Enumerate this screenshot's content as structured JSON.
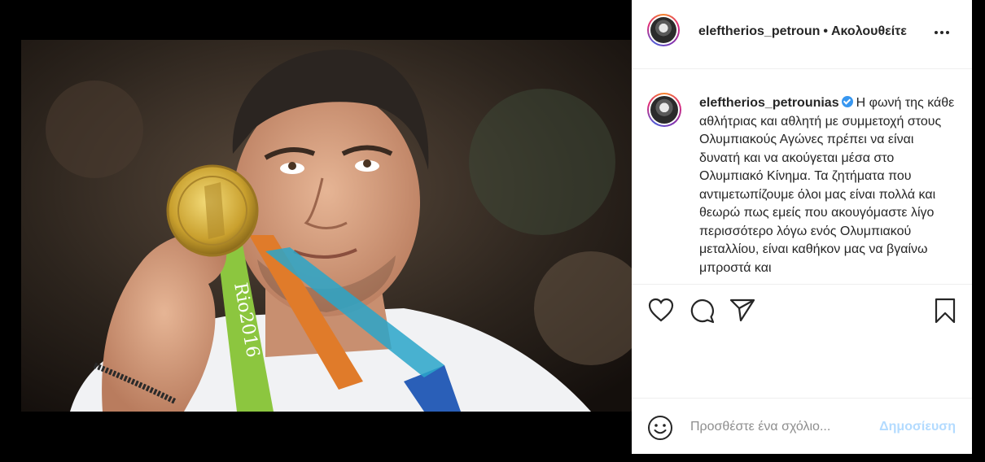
{
  "post": {
    "image_alt": "Athlete kissing gold medal",
    "medal_ribbon_text": "Rio2016"
  },
  "header": {
    "username": "eleftherios_petroun",
    "separator": "•",
    "follow_label": "Ακολουθείτε"
  },
  "caption": {
    "username": "eleftherios_petrounias",
    "text": "Η φωνή της κάθε αθλήτριας και αθλητή με συμμετοχή στους Ολυμπιακούς Αγώνες πρέπει να είναι δυνατή και να ακούγεται μέσα στο Ολυμπιακό Κίνημα. Τα ζητήματα που αντιμετωπίζουμε όλοι μας είναι πολλά και θεωρώ πως εμείς που ακουγόμαστε λίγο περισσότερο λόγω ενός Ολυμπιακού μεταλλίου, είναι καθήκον μας να βγαίνω μπροστά και"
  },
  "actions": {
    "like_icon": "heart-icon",
    "comment_icon": "comment-icon",
    "share_icon": "paper-plane-icon",
    "save_icon": "bookmark-icon"
  },
  "comment": {
    "placeholder": "Προσθέστε ένα σχόλιο...",
    "post_label": "Δημοσίευση"
  },
  "colors": {
    "post_button_disabled": "#b3dbff",
    "text": "#262626",
    "muted": "#8e8e8e"
  }
}
